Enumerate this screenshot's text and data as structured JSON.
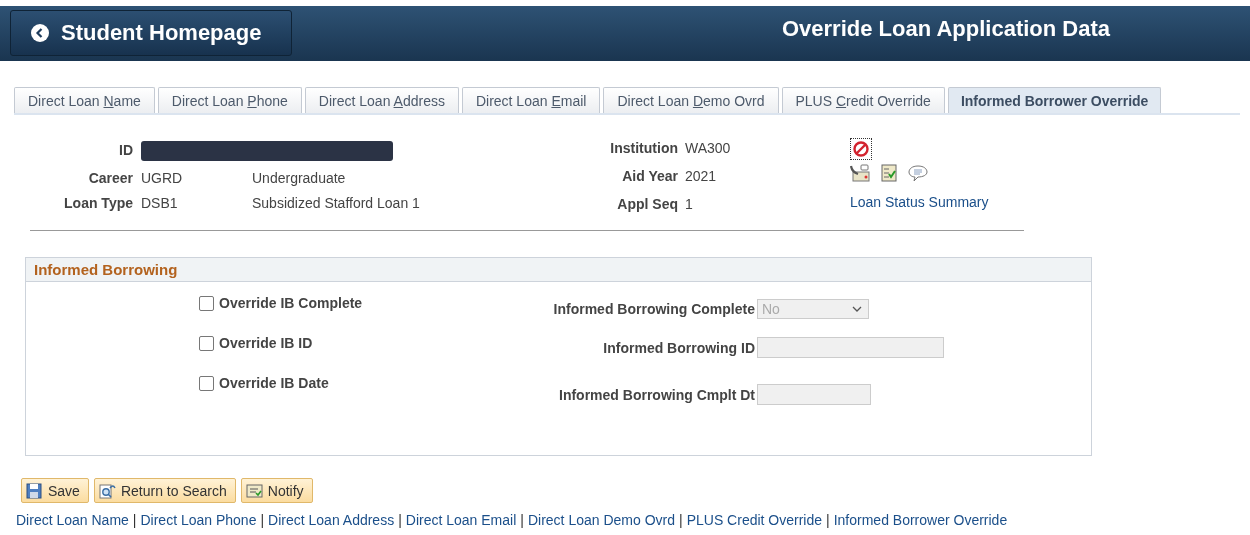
{
  "header": {
    "home_button": "Student Homepage",
    "title": "Override Loan Application Data"
  },
  "tabs": [
    {
      "before": "Direct Loan ",
      "key": "N",
      "after": "ame",
      "selected": false
    },
    {
      "before": "Direct Loan ",
      "key": "P",
      "after": "hone",
      "selected": false
    },
    {
      "before": "Direct Loan ",
      "key": "A",
      "after": "ddress",
      "selected": false
    },
    {
      "before": "Direct Loan ",
      "key": "E",
      "after": "mail",
      "selected": false
    },
    {
      "before": "Direct Loan ",
      "key": "D",
      "after": "emo Ovrd",
      "selected": false
    },
    {
      "before": "PLUS ",
      "key": "C",
      "after": "redit Override",
      "selected": false
    },
    {
      "before": "Informed Borrower Override",
      "selected": true
    }
  ],
  "info_left": [
    {
      "kind": "redacted",
      "label": "ID"
    },
    {
      "kind": "value",
      "label": "Career",
      "code": "UGRD",
      "description": "Undergraduate"
    },
    {
      "kind": "value",
      "label": "Loan Type",
      "code": "DSB1",
      "description": "Subsidized Stafford Loan 1"
    }
  ],
  "info_right": [
    {
      "label": "Institution",
      "value": "WA300"
    },
    {
      "label": "Aid Year",
      "value": "2021"
    },
    {
      "label": "Appl Seq",
      "value": "1"
    }
  ],
  "status_link": "Loan Status Summary",
  "group": {
    "title": "Informed Borrowing",
    "checkboxes": [
      {
        "label": "Override IB Complete",
        "checked": false
      },
      {
        "label": "Override IB ID",
        "checked": false
      },
      {
        "label": "Override IB Date",
        "checked": false
      }
    ],
    "fields": [
      {
        "kind": "select",
        "label": "Informed Borrowing Complete",
        "value": "No",
        "disabled": true
      },
      {
        "kind": "text",
        "label": "Informed Borrowing ID",
        "disabled": true
      },
      {
        "kind": "date",
        "label": "Informed Borrowing Cmplt Dt",
        "disabled": true
      }
    ]
  },
  "buttons": [
    {
      "kind": "save",
      "label": "Save"
    },
    {
      "kind": "search",
      "label": "Return to Search"
    },
    {
      "kind": "notify",
      "label": "Notify"
    }
  ],
  "footer_links": [
    {
      "kind": "link",
      "text": "Direct Loan Name"
    },
    {
      "kind": "separator",
      "text": "|"
    },
    {
      "kind": "link",
      "text": "Direct Loan Phone"
    },
    {
      "kind": "separator",
      "text": "|"
    },
    {
      "kind": "link",
      "text": "Direct Loan Address"
    },
    {
      "kind": "separator",
      "text": "|"
    },
    {
      "kind": "link",
      "text": "Direct Loan Email"
    },
    {
      "kind": "separator",
      "text": "|"
    },
    {
      "kind": "link",
      "text": "Direct Loan Demo Ovrd"
    },
    {
      "kind": "separator",
      "text": "|"
    },
    {
      "kind": "link",
      "text": "PLUS Credit Override"
    },
    {
      "kind": "separator",
      "text": "|"
    },
    {
      "kind": "link",
      "text": "Informed Borrower Override"
    }
  ]
}
